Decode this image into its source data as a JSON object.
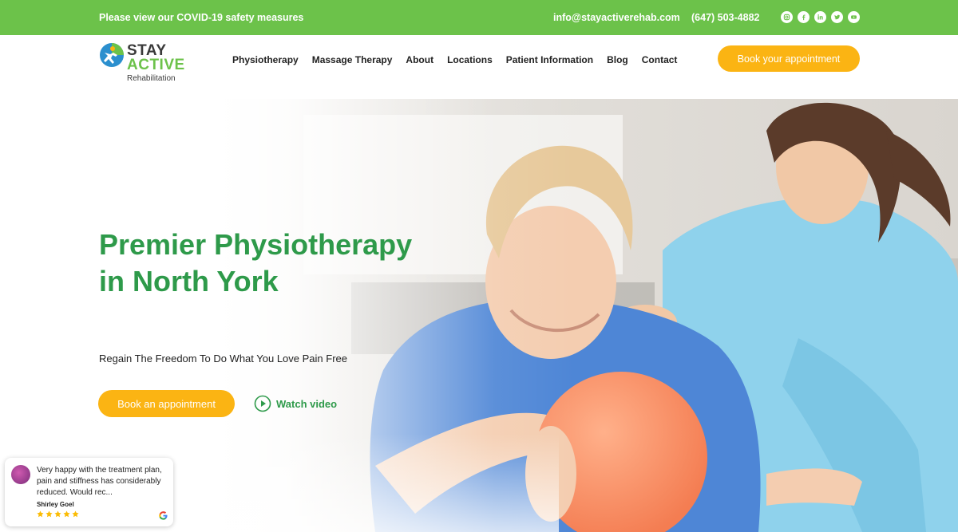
{
  "topbar": {
    "covid_text": "Please view our COVID-19 safety measures",
    "email": "info@stayactiverehab.com",
    "phone": "(647) 503-4882",
    "socials": [
      "instagram-icon",
      "facebook-icon",
      "linkedin-icon",
      "twitter-icon",
      "youtube-icon"
    ]
  },
  "logo": {
    "line1": "STAY",
    "line2": "ACTIVE",
    "line3": "Rehabilitation"
  },
  "nav": {
    "items": [
      "Physiotherapy",
      "Massage Therapy",
      "About",
      "Locations",
      "Patient Information",
      "Blog",
      "Contact"
    ]
  },
  "header": {
    "book_button": "Book your appointment"
  },
  "hero": {
    "headline": "Premier Physiotherapy in North York",
    "subheadline": "Regain The Freedom To Do What You Love Pain Free",
    "book_button": "Book an appointment",
    "watch_video": "Watch video"
  },
  "review": {
    "text": "Very happy with the treatment plan, pain and stiffness has considerably reduced. Would rec...",
    "author": "Shirley Goel",
    "rating": 5
  },
  "colors": {
    "brand_green": "#6cc24a",
    "heading_green": "#2e9a4a",
    "accent_yellow": "#fbb413"
  }
}
